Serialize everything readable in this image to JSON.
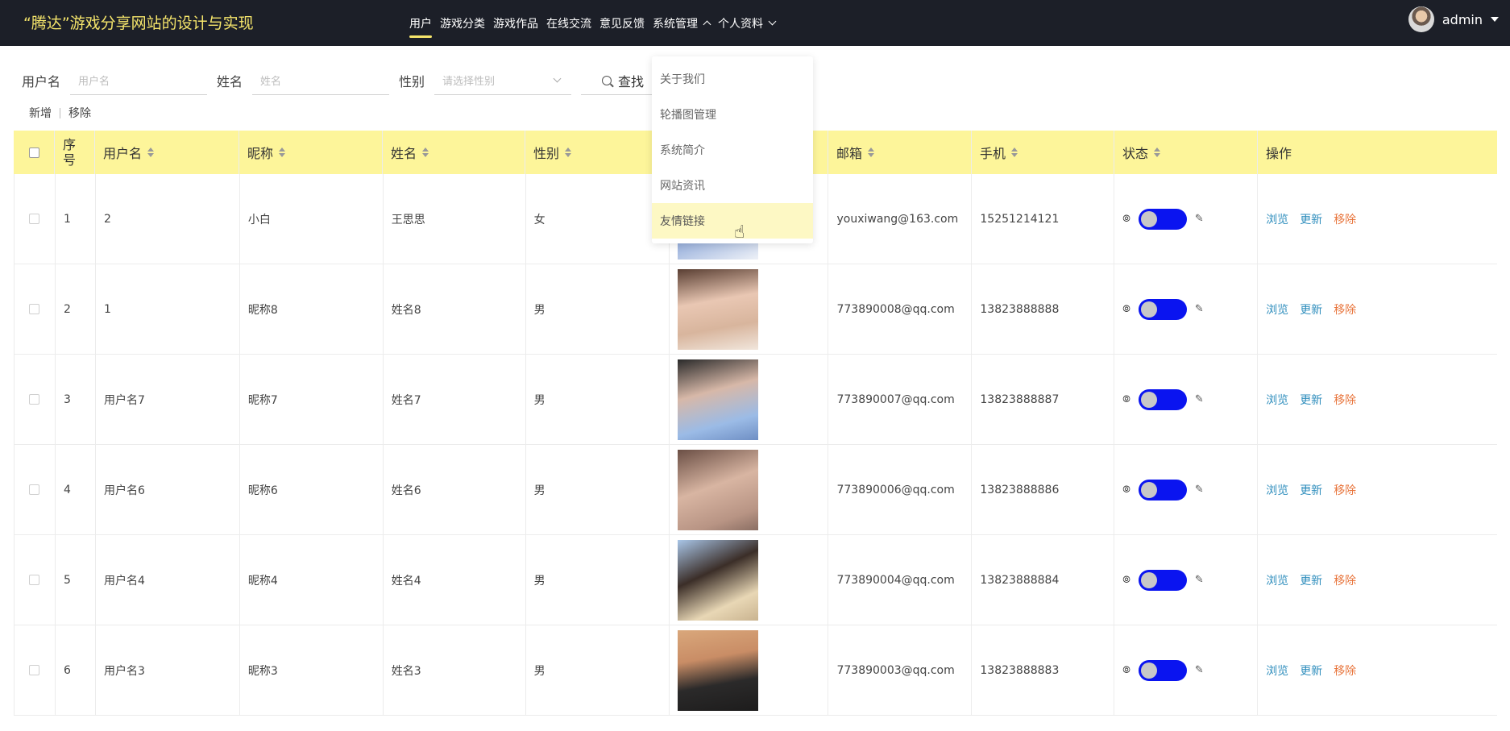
{
  "brand": "“腾达”游戏分享网站的设计与实现",
  "nav": [
    {
      "label": "用户"
    },
    {
      "label": "游戏分类"
    },
    {
      "label": "游戏作品"
    },
    {
      "label": "在线交流"
    },
    {
      "label": "意见反馈"
    },
    {
      "label": "系统管理"
    },
    {
      "label": "个人资料"
    }
  ],
  "user": {
    "name": "admin"
  },
  "search": {
    "username_label": "用户名",
    "username_placeholder": "用户名",
    "name_label": "姓名",
    "name_placeholder": "姓名",
    "gender_label": "性别",
    "gender_placeholder": "请选择性别",
    "find_label": "查找"
  },
  "actions": {
    "add": "新增",
    "remove": "移除"
  },
  "dropdown": [
    {
      "label": "关于我们"
    },
    {
      "label": "轮播图管理"
    },
    {
      "label": "系统简介"
    },
    {
      "label": "网站资讯"
    },
    {
      "label": "友情链接"
    }
  ],
  "table": {
    "headers": {
      "index": "序\n号",
      "username": "用户名",
      "nickname": "昵称",
      "name": "姓名",
      "gender": "性别",
      "email": "邮箱",
      "phone": "手机",
      "status": "状态",
      "ops": "操作"
    },
    "row_ops": {
      "view": "浏览",
      "edit": "更新",
      "delete": "移除"
    },
    "rows": [
      {
        "index": "1",
        "username": "2",
        "nickname": "小白",
        "name": "王思思",
        "gender": "女",
        "email": "youxiwang@163.com",
        "phone": "15251214121"
      },
      {
        "index": "2",
        "username": "1",
        "nickname": "昵称8",
        "name": "姓名8",
        "gender": "男",
        "email": "773890008@qq.com",
        "phone": "13823888888"
      },
      {
        "index": "3",
        "username": "用户名7",
        "nickname": "昵称7",
        "name": "姓名7",
        "gender": "男",
        "email": "773890007@qq.com",
        "phone": "13823888887"
      },
      {
        "index": "4",
        "username": "用户名6",
        "nickname": "昵称6",
        "name": "姓名6",
        "gender": "男",
        "email": "773890006@qq.com",
        "phone": "13823888886"
      },
      {
        "index": "5",
        "username": "用户名4",
        "nickname": "昵称4",
        "name": "姓名4",
        "gender": "男",
        "email": "773890004@qq.com",
        "phone": "13823888884"
      },
      {
        "index": "6",
        "username": "用户名3",
        "nickname": "昵称3",
        "name": "姓名3",
        "gender": "男",
        "email": "773890003@qq.com",
        "phone": "13823888883"
      }
    ]
  },
  "colors": {
    "topbar": "#1c1f28",
    "accent": "#f5e56b",
    "header_row": "#fdf59a",
    "toggle_on": "#0a14f0",
    "link": "#2f8ebd",
    "danger": "#e8743b"
  }
}
